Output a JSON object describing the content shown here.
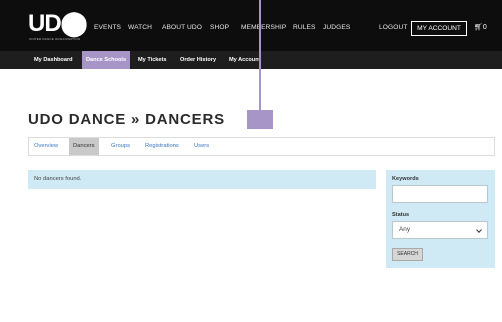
{
  "brand": {
    "logo_text": "UD",
    "tagline": "UNITED DANCE ORGANISATION"
  },
  "topnav": {
    "items": [
      "EVENTS",
      "WATCH",
      "ABOUT UDO",
      "SHOP",
      "MEMBERSHIP",
      "RULES",
      "JUDGES"
    ],
    "logout": "LOGOUT",
    "my_account": "MY ACCOUNT",
    "cart_count": "0"
  },
  "subnav": {
    "items": [
      "My Dashboard",
      "Dance Schools",
      "My Tickets",
      "Order History",
      "My Account"
    ],
    "active_index": 1
  },
  "page": {
    "title": "UDO DANCE » DANCERS"
  },
  "tabs": {
    "items": [
      "Overview",
      "Dancers",
      "Groups",
      "Registrations",
      "Users"
    ],
    "active_index": 1
  },
  "notice": {
    "text": "No dancers found."
  },
  "filter": {
    "keywords_label": "Keywords",
    "keywords_value": "",
    "status_label": "Status",
    "status_selected": "Any",
    "search_label": "SEARCH"
  },
  "colors": {
    "accent": "#a795c8",
    "topbar": "#0d0d0d",
    "subnav": "#1e1e1e",
    "notice_bg": "#cfeaf5",
    "link": "#3a78c2"
  }
}
